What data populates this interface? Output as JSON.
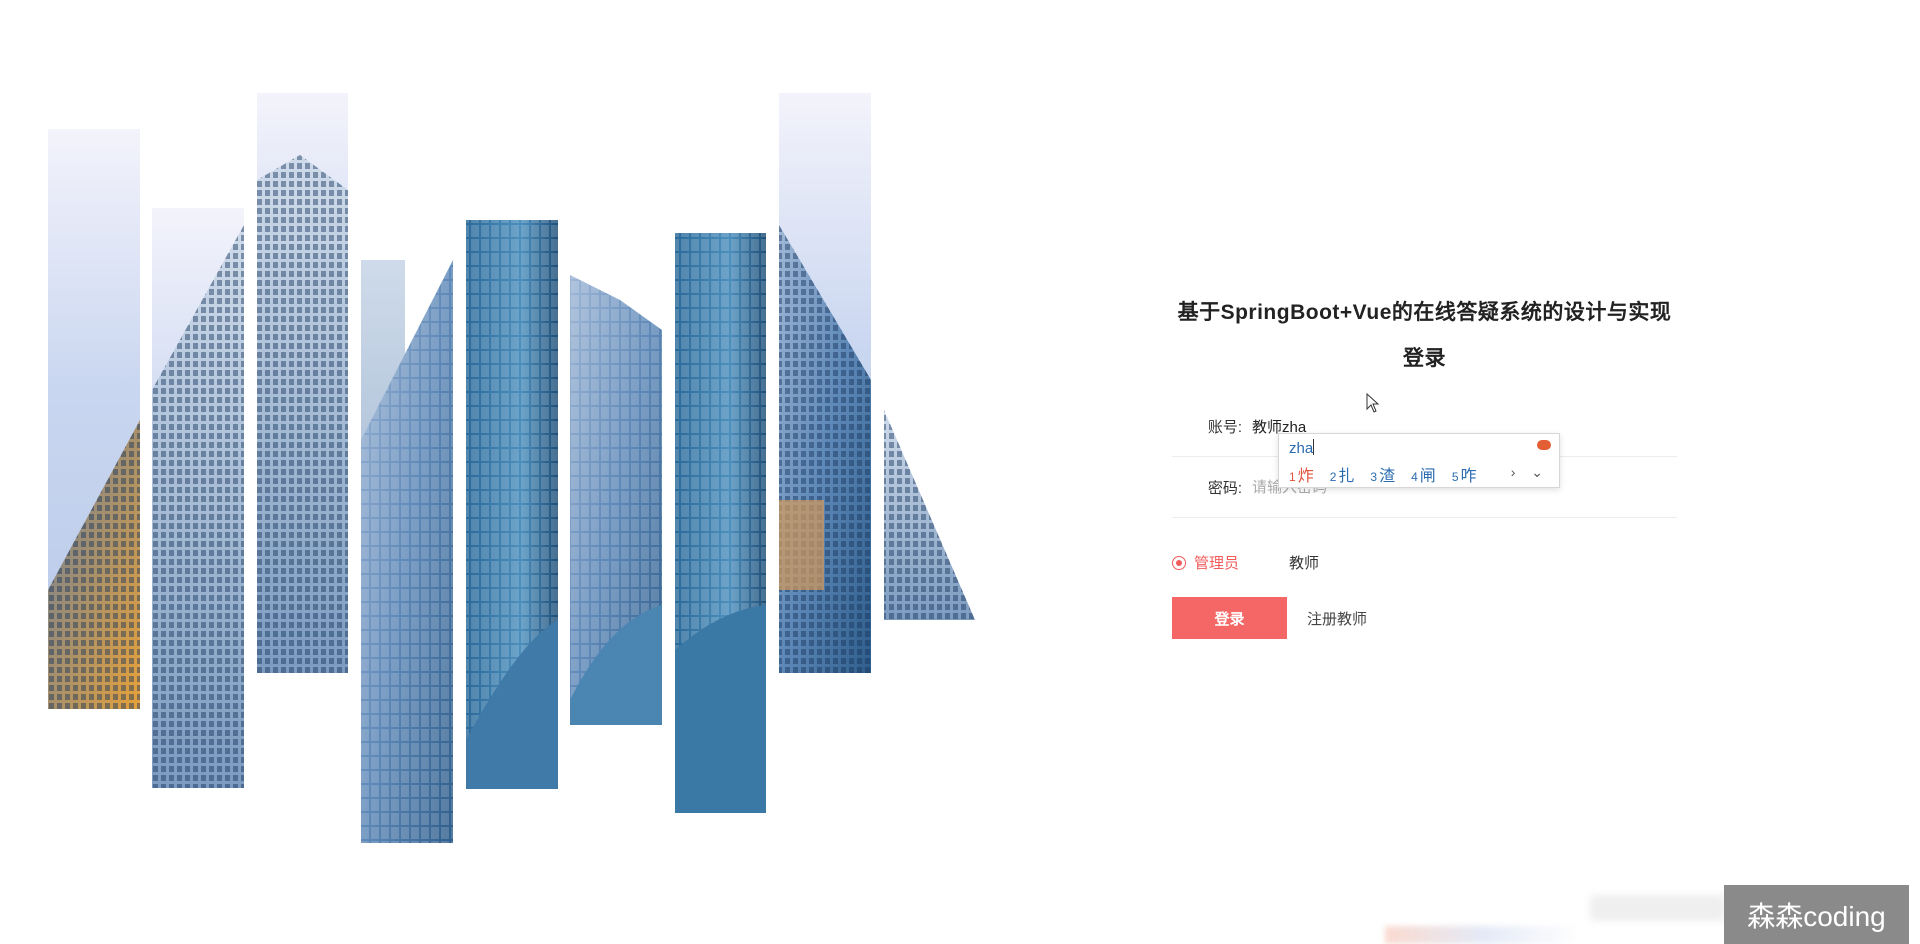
{
  "login": {
    "title": "基于SpringBoot+Vue的在线答疑系统的设计与实现登录",
    "account_label": "账号:",
    "account_value": "教师zha",
    "password_label": "密码:",
    "password_placeholder": "请输入密码",
    "roles": [
      {
        "label": "管理员",
        "checked": true
      },
      {
        "label": "教师",
        "checked": false
      }
    ],
    "login_button": "登录",
    "register_link": "注册教师"
  },
  "ime": {
    "composition": "zha",
    "candidates": [
      {
        "num": "1",
        "text": "炸"
      },
      {
        "num": "2",
        "text": "扎"
      },
      {
        "num": "3",
        "text": "渣"
      },
      {
        "num": "4",
        "text": "闸"
      },
      {
        "num": "5",
        "text": "咋"
      }
    ],
    "nav": "› ⌄"
  },
  "watermark": "森森coding",
  "colors": {
    "accent": "#f56767",
    "ime_blue": "#2b6cb0",
    "ime_first": "#e0533c"
  }
}
